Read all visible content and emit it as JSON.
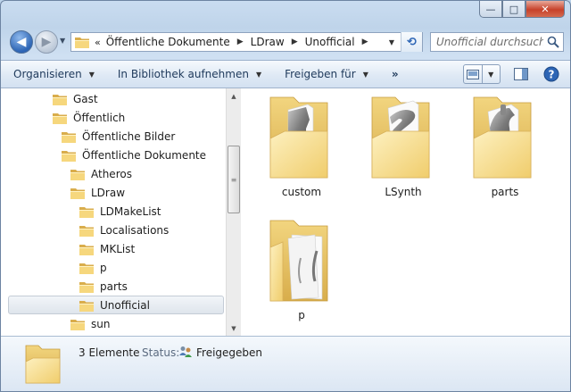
{
  "window": {
    "minimize_glyph": "—",
    "maximize_glyph": "□",
    "close_glyph": "✕"
  },
  "address_bar": {
    "overflow_glyph": "«",
    "crumbs": [
      "Öffentliche Dokumente",
      "LDraw",
      "Unofficial"
    ],
    "separator_glyph": "▶",
    "dropdown_glyph": "▼",
    "refresh_glyph": "⟲"
  },
  "search": {
    "placeholder": "Unofficial durchsuch..."
  },
  "toolbar": {
    "organize": "Organisieren",
    "add_to_library": "In Bibliothek aufnehmen",
    "share_with": "Freigeben für",
    "more": "»",
    "arrow_glyph": "▼"
  },
  "navigation": {
    "items": [
      {
        "label": "Gast",
        "level": 0
      },
      {
        "label": "Öffentlich",
        "level": 0
      },
      {
        "label": "Öffentliche Bilder",
        "level": 1
      },
      {
        "label": "Öffentliche Dokumente",
        "level": 1
      },
      {
        "label": "Atheros",
        "level": 2
      },
      {
        "label": "LDraw",
        "level": 2
      },
      {
        "label": "LDMakeList",
        "level": 3
      },
      {
        "label": "Localisations",
        "level": 3
      },
      {
        "label": "MKList",
        "level": 3
      },
      {
        "label": "p",
        "level": 3
      },
      {
        "label": "parts",
        "level": 3
      },
      {
        "label": "Unofficial",
        "level": 3,
        "selected": true
      },
      {
        "label": "sun",
        "level": 2
      }
    ]
  },
  "files": [
    {
      "name": "custom",
      "preview": "mechanical-part"
    },
    {
      "name": "LSynth",
      "preview": "hose-part"
    },
    {
      "name": "parts",
      "preview": "round-part"
    },
    {
      "name": "p",
      "preview": "sheets"
    }
  ],
  "details": {
    "item_count": "3 Elemente",
    "status_label": "Status:",
    "status_value": "Freigegeben"
  },
  "colors": {
    "folder_light": "#fbe7a2",
    "folder_dark": "#e2bb5a",
    "accent_blue": "#2d65b5",
    "selection": "#dfe5ec"
  }
}
